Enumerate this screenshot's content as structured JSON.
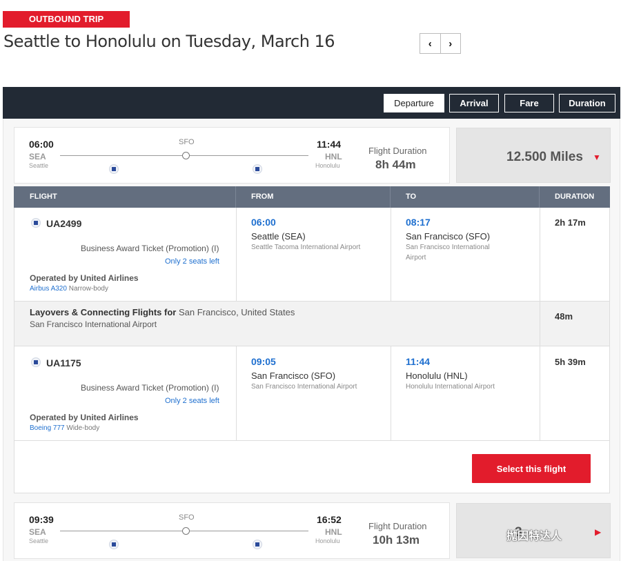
{
  "header": {
    "badge": "OUTBOUND TRIP",
    "title": "Seattle to Honolulu on Tuesday, March 16",
    "prev_glyph": "‹",
    "next_glyph": "›"
  },
  "sort_bar": {
    "options": [
      "Departure",
      "Arrival",
      "Fare",
      "Duration"
    ],
    "active": "Departure"
  },
  "results": [
    {
      "depart_time": "06:00",
      "depart_code": "SEA",
      "depart_city": "Seattle",
      "stop_code": "SFO",
      "arrive_time": "11:44",
      "arrive_code": "HNL",
      "arrive_city": "Honolulu",
      "duration_label": "Flight Duration",
      "duration": "8h 44m",
      "miles": "12.500 Miles",
      "expanded": true,
      "details": {
        "columns": [
          "FLIGHT",
          "FROM",
          "TO",
          "DURATION"
        ],
        "segments": [
          {
            "flight": "UA2499",
            "fare": "Business Award Ticket (Promotion) (I)",
            "seats": "Only 2 seats left",
            "operated_by": "Operated by United Airlines",
            "aircraft_link": "Airbus A320",
            "aircraft_body": "Narrow-body",
            "from_time": "06:00",
            "from_city": "Seattle (SEA)",
            "from_airport": "Seattle Tacoma International Airport",
            "to_time": "08:17",
            "to_city": "San Francisco (SFO)",
            "to_airport": "San Francisco International Airport",
            "duration": "2h 17m"
          },
          {
            "flight": "UA1175",
            "fare": "Business Award Ticket (Promotion) (I)",
            "seats": "Only 2 seats left",
            "operated_by": "Operated by United Airlines",
            "aircraft_link": "Boeing 777",
            "aircraft_body": "Wide-body",
            "from_time": "09:05",
            "from_city": "San Francisco (SFO)",
            "from_airport": "San Francisco International Airport",
            "to_time": "11:44",
            "to_city": "Honolulu (HNL)",
            "to_airport": "Honolulu International Airport",
            "duration": "5h 39m"
          }
        ],
        "layover": {
          "title": "Layovers & Connecting Flights for",
          "location": "San Francisco, United States",
          "airport": "San Francisco International Airport",
          "duration": "48m"
        },
        "select_label": "Select this flight"
      }
    },
    {
      "depart_time": "09:39",
      "depart_code": "SEA",
      "depart_city": "Seattle",
      "stop_code": "SFO",
      "arrive_time": "16:52",
      "arrive_code": "HNL",
      "arrive_city": "Honolulu",
      "duration_label": "Flight Duration",
      "duration": "10h 13m",
      "miles": "3",
      "expanded": false
    }
  ],
  "watermark": "抛因特达人",
  "colors": {
    "accent_red": "#e21c2c",
    "dark_bar": "#222a35",
    "table_header": "#636e7f",
    "link_blue": "#1e6fcf"
  }
}
